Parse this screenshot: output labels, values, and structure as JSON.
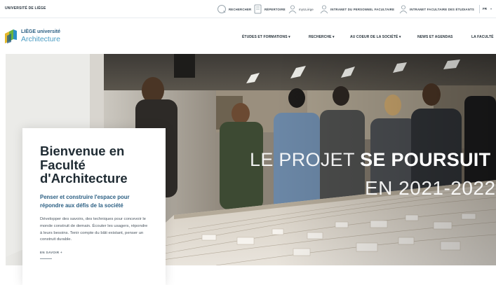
{
  "topbar": {
    "university": "UNIVERSITÉ DE LIÈGE",
    "utilities": [
      {
        "icon": "search-icon",
        "label": "RECHERCHER"
      },
      {
        "icon": "directory-icon",
        "label": "RÉPERTOIRE"
      },
      {
        "icon": "user-icon",
        "label": "myULiège"
      },
      {
        "icon": "user-icon",
        "label": "INTRANET DU PERSONNEL FACULTAIRE"
      },
      {
        "icon": "user-icon",
        "label": "INTRANET FACULTAIRE DES ÉTUDIANTS"
      }
    ],
    "language": "FR"
  },
  "brand": {
    "line1": "LIÈGE université",
    "line2": "Architecture"
  },
  "nav": {
    "items": [
      "ÉTUDES ET FORMATIONS ▾",
      "RECHERCHE ▾",
      "AU COEUR DE LA SOCIÉTÉ ▾",
      "NEWS ET AGENDAS",
      "LA FACULTÉ"
    ]
  },
  "hero": {
    "tagline_light": "LE PROJET ",
    "tagline_bold": "SE POURSUIT",
    "tagline_years": "EN 2021-2022"
  },
  "card": {
    "title": "Bienvenue en Faculté d'Architecture",
    "subtitle": "Penser et construire l'espace pour répondre aux défis de la société",
    "text": "Développer des savoirs, des techniques pour concevoir le monde construit de demain. Écouter les usagers, répondre à leurs besoins. Tenir compte du bâti existant, penser un construit durable.",
    "link": "EN SAVOIR +"
  },
  "colors": {
    "brand_blue": "#2b5f83",
    "brand_light_blue": "#4a9cc3",
    "text_dark": "#1f2b33"
  }
}
